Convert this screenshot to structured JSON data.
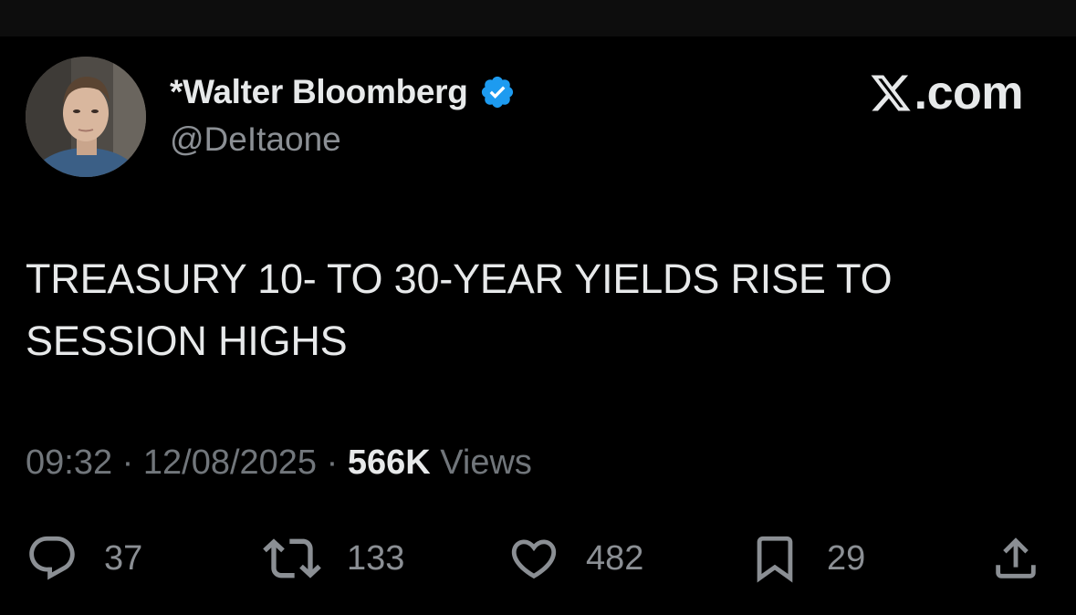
{
  "author": {
    "display_name": "*Walter Bloomberg",
    "handle": "@DeItaone",
    "verified": true,
    "verified_color": "#1d9bf0"
  },
  "brand": {
    "label": ".com",
    "icon": "x-logo-icon"
  },
  "tweet": {
    "line1": "TREASURY 10- TO 30-YEAR YIELDS RISE TO",
    "line2": "SESSION HIGHS"
  },
  "meta": {
    "time": "09:32",
    "separator": "·",
    "date": "12/08/2025",
    "views_count": "566K",
    "views_label": "Views"
  },
  "actions": {
    "replies": {
      "icon": "reply-icon",
      "count": "37"
    },
    "reposts": {
      "icon": "repost-icon",
      "count": "133"
    },
    "likes": {
      "icon": "heart-icon",
      "count": "482"
    },
    "bookmarks": {
      "icon": "bookmark-icon",
      "count": "29"
    },
    "share": {
      "icon": "share-icon"
    }
  },
  "colors": {
    "background": "#000000",
    "primary_text": "#e7e9ea",
    "secondary_text": "#71767b",
    "accent": "#1d9bf0"
  }
}
